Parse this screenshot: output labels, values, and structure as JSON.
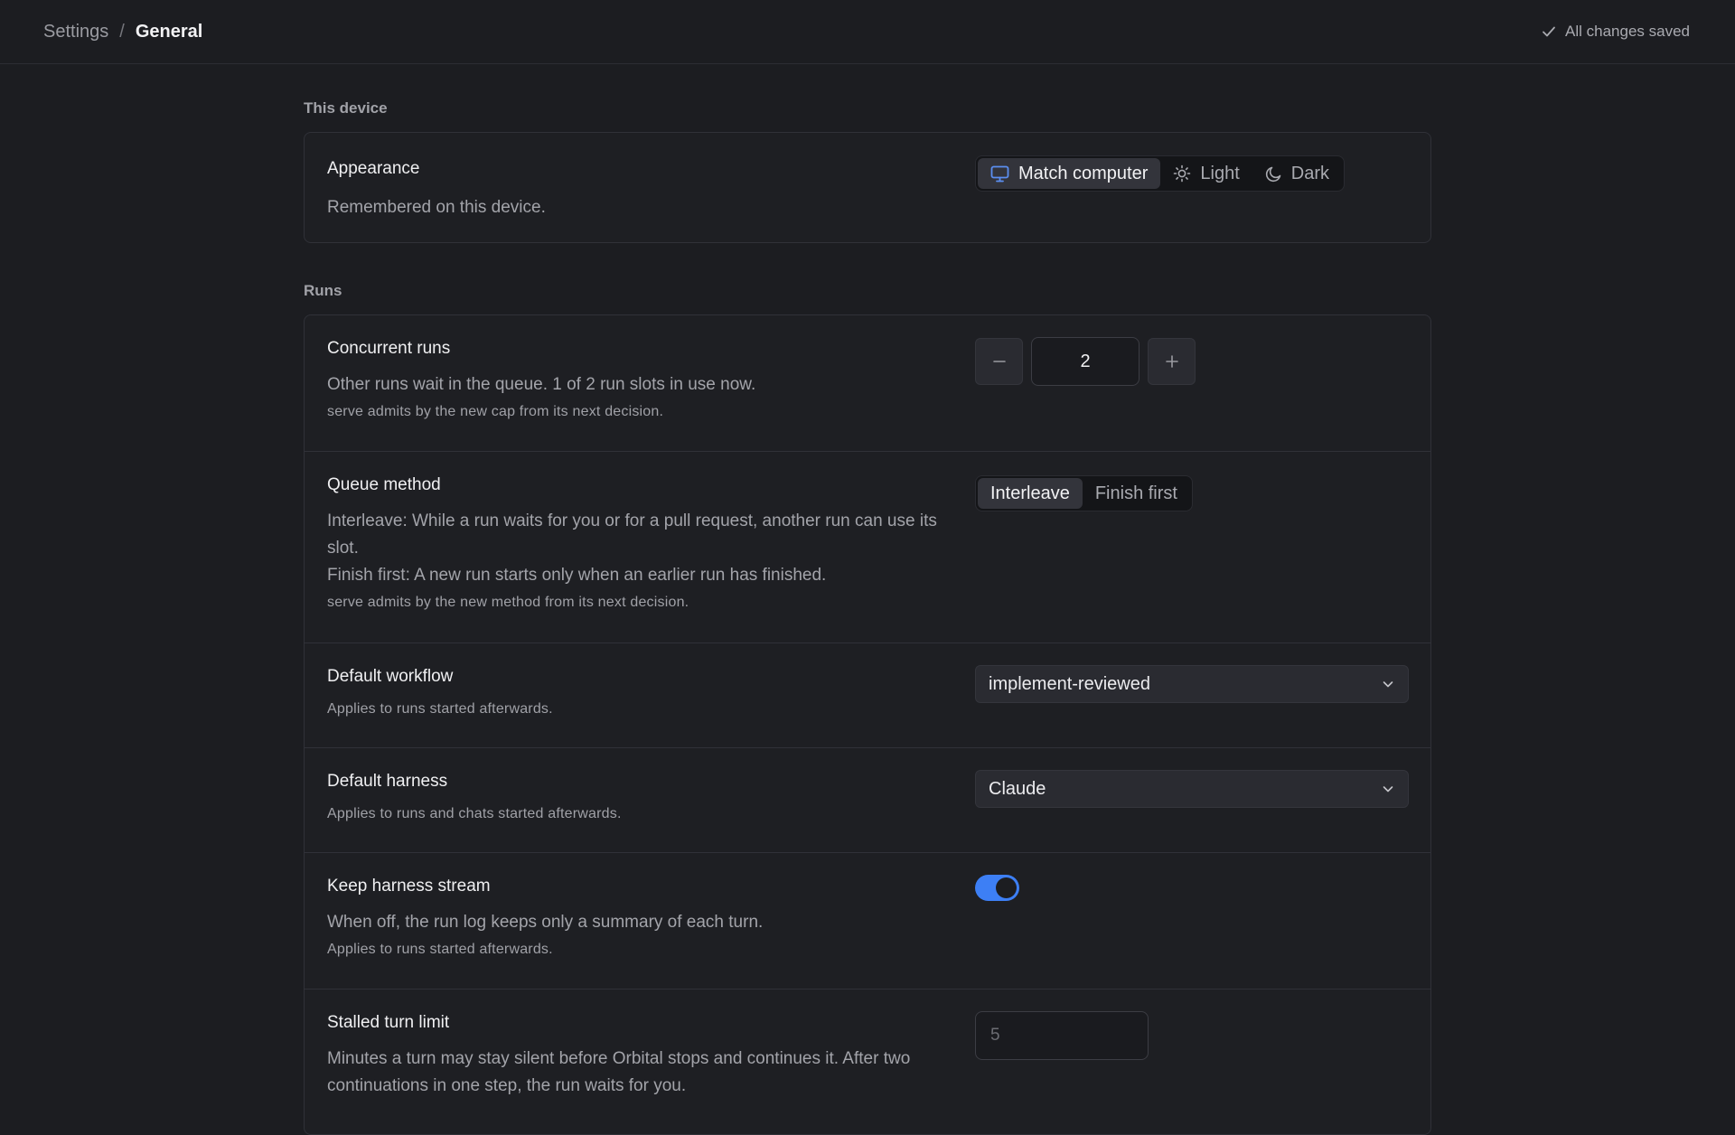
{
  "breadcrumb": {
    "parent": "Settings",
    "separator": "/",
    "current": "General"
  },
  "status": {
    "text": "All changes saved",
    "icon": "check-icon"
  },
  "sections": {
    "device": {
      "label": "This device",
      "appearance": {
        "title": "Appearance",
        "description": "Remembered on this device.",
        "options": [
          {
            "label": "Match computer",
            "icon": "monitor-icon",
            "selected": true
          },
          {
            "label": "Light",
            "icon": "sun-icon",
            "selected": false
          },
          {
            "label": "Dark",
            "icon": "moon-icon",
            "selected": false
          }
        ]
      }
    },
    "runs": {
      "label": "Runs",
      "concurrent": {
        "title": "Concurrent runs",
        "description": "Other runs wait in the queue. 1 of 2 run slots in use now.",
        "note": "serve admits by the new cap from its next decision.",
        "value": "2"
      },
      "queue": {
        "title": "Queue method",
        "description1": "Interleave: While a run waits for you or for a pull request, another run can use its slot.",
        "description2": "Finish first: A new run starts only when an earlier run has finished.",
        "note": "serve admits by the new method from its next decision.",
        "options": [
          {
            "label": "Interleave",
            "selected": true
          },
          {
            "label": "Finish first",
            "selected": false
          }
        ]
      },
      "workflow": {
        "title": "Default workflow",
        "note": "Applies to runs started afterwards.",
        "value": "implement-reviewed"
      },
      "harness": {
        "title": "Default harness",
        "note": "Applies to runs and chats started afterwards.",
        "value": "Claude"
      },
      "stream": {
        "title": "Keep harness stream",
        "description": "When off, the run log keeps only a summary of each turn.",
        "note": "Applies to runs started afterwards.",
        "enabled": true
      },
      "stalled": {
        "title": "Stalled turn limit",
        "description": "Minutes a turn may stay silent before Orbital stops and continues it. After two continuations in one step, the run waits for you.",
        "placeholder": "5"
      }
    }
  },
  "colors": {
    "accent": "#3d7ff5",
    "background": "#1c1d21",
    "card": "#1e1f23"
  }
}
